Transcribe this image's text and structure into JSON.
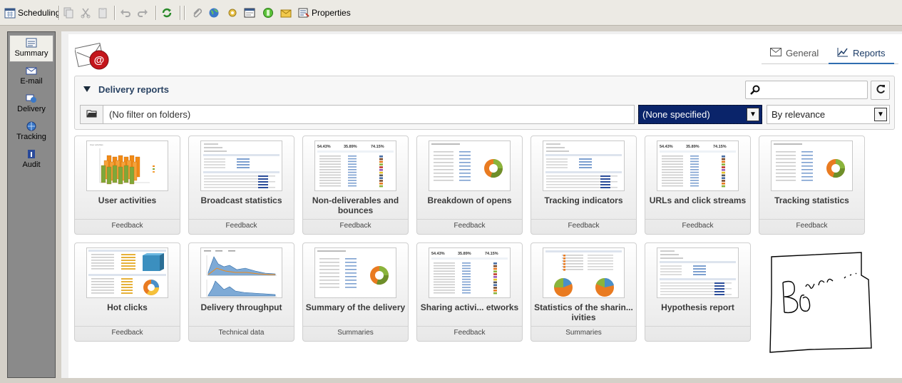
{
  "toolbar": {
    "scheduling_label": "Scheduling",
    "properties_label": "Properties"
  },
  "sidebar": {
    "items": [
      {
        "label": "Summary",
        "active": true
      },
      {
        "label": "E-mail"
      },
      {
        "label": "Delivery"
      },
      {
        "label": "Tracking"
      },
      {
        "label": "Audit"
      }
    ]
  },
  "tabs": {
    "general": "General",
    "reports": "Reports"
  },
  "panel": {
    "title": "Delivery reports",
    "filter_text": "(No filter on folders)",
    "category_select": "(None specified)",
    "sort_select": "By relevance"
  },
  "reports": [
    {
      "title": "User activities",
      "category": "Feedback",
      "thumb": "bars3d"
    },
    {
      "title": "Broadcast statistics",
      "category": "Feedback",
      "thumb": "form"
    },
    {
      "title": "Non-deliverables and bounces",
      "category": "Feedback",
      "thumb": "stats"
    },
    {
      "title": "Breakdown of opens",
      "category": "Feedback",
      "thumb": "donut"
    },
    {
      "title": "Tracking indicators",
      "category": "Feedback",
      "thumb": "form"
    },
    {
      "title": "URLs and click streams",
      "category": "Feedback",
      "thumb": "stats"
    },
    {
      "title": "Tracking statistics",
      "category": "Feedback",
      "thumb": "donut"
    },
    {
      "title": "Hot clicks",
      "category": "Feedback",
      "thumb": "hot"
    },
    {
      "title": "Delivery throughput",
      "category": "Technical data",
      "thumb": "area"
    },
    {
      "title": "Summary of the delivery",
      "category": "Summaries",
      "thumb": "donut"
    },
    {
      "title": "Sharing activi... etworks",
      "category": "Feedback",
      "thumb": "stats"
    },
    {
      "title": "Statistics of the sharin... ivities",
      "category": "Summaries",
      "thumb": "pies"
    },
    {
      "title": "Hypothesis report",
      "category": "",
      "thumb": "form"
    }
  ],
  "thumb_stat_values": [
    "54.43%",
    "35.89%",
    "74.15%"
  ],
  "colors": {
    "accent": "#2f6db0",
    "selected_bg": "#0a246a",
    "bar_orange": "#f28a16",
    "donut_green": "#8ab43c",
    "donut_orange": "#e97b21"
  }
}
